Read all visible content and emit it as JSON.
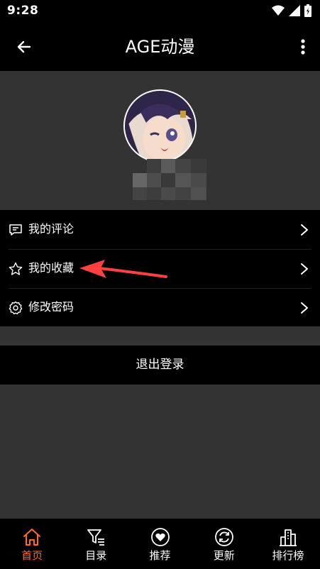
{
  "status_bar": {
    "time": "9:28"
  },
  "app_bar": {
    "title": "AGE动漫"
  },
  "menu": {
    "items": [
      {
        "label": "我的评论"
      },
      {
        "label": "我的收藏"
      },
      {
        "label": "修改密码"
      }
    ]
  },
  "logout": {
    "label": "退出登录"
  },
  "bottom_nav": {
    "items": [
      {
        "label": "首页"
      },
      {
        "label": "目录"
      },
      {
        "label": "推荐"
      },
      {
        "label": "更新"
      },
      {
        "label": "排行榜"
      }
    ],
    "active_index": 0
  },
  "colors": {
    "accent": "#ff6a2b",
    "annotation_arrow": "#ff4040",
    "background": "#333333",
    "surface": "#000000"
  }
}
